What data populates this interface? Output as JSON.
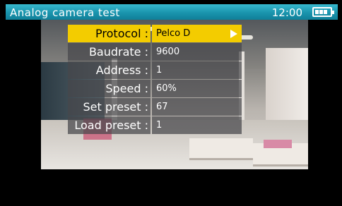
{
  "header": {
    "title": "Analog camera test",
    "time": "12:00",
    "battery_icon": "battery-full-icon"
  },
  "menu": {
    "items": [
      {
        "label": "Protocol :",
        "value": "Pelco D"
      },
      {
        "label": "Baudrate :",
        "value": "9600"
      },
      {
        "label": "Address :",
        "value": "1"
      },
      {
        "label": "Speed :",
        "value": "60%"
      },
      {
        "label": "Set preset :",
        "value": "67"
      },
      {
        "label": "Load preset :",
        "value": "1"
      }
    ],
    "selected_color": "#f3cc00"
  },
  "colors": {
    "titlebar": "#1a94ad",
    "background": "#000000"
  }
}
